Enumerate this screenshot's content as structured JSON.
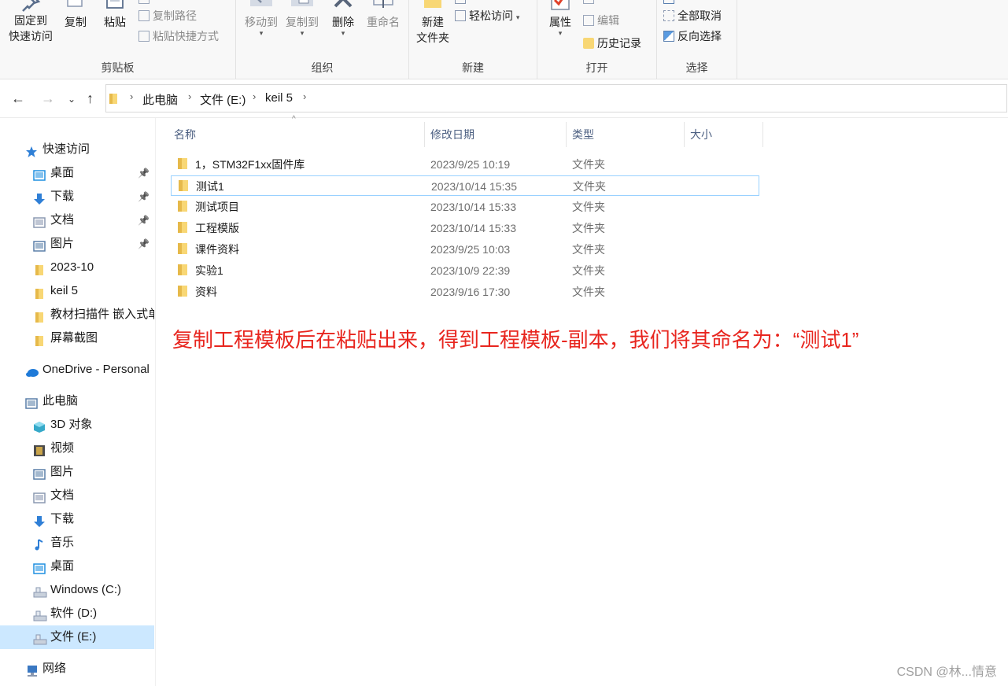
{
  "ribbon": {
    "clipboard": {
      "group_label": "剪贴板",
      "pin_label_1": "固定到",
      "pin_label_2": "快速访问",
      "copy_label": "复制",
      "paste_label": "粘贴",
      "copy_path_label": "复制路径",
      "paste_shortcut_label": "粘贴快捷方式"
    },
    "organize": {
      "group_label": "组织",
      "move_to_label": "移动到",
      "copy_to_label": "复制到",
      "delete_label": "删除",
      "rename_label": "重命名"
    },
    "new": {
      "group_label": "新建",
      "new_folder_label_1": "新建",
      "new_folder_label_2": "文件夹",
      "easy_access_label": "轻松访问"
    },
    "open": {
      "group_label": "打开",
      "properties_label": "属性",
      "edit_label": "编辑",
      "history_label": "历史记录"
    },
    "select": {
      "group_label": "选择",
      "select_none_label": "全部取消",
      "invert_selection_label": "反向选择"
    }
  },
  "address": {
    "crumbs": [
      "此电脑",
      "文件 (E:)",
      "keil 5"
    ]
  },
  "sidebar": {
    "items": [
      {
        "label": "快速访问",
        "icon": "star-icon"
      },
      {
        "label": "桌面",
        "icon": "desktop-icon",
        "pinned": true
      },
      {
        "label": "下载",
        "icon": "download-icon",
        "pinned": true
      },
      {
        "label": "文档",
        "icon": "document-icon",
        "pinned": true
      },
      {
        "label": "图片",
        "icon": "picture-icon",
        "pinned": true
      },
      {
        "label": "2023-10",
        "icon": "folder-icon"
      },
      {
        "label": "keil 5",
        "icon": "folder-icon"
      },
      {
        "label": "教材扫描件 嵌入式单",
        "icon": "folder-icon"
      },
      {
        "label": "屏幕截图",
        "icon": "folder-icon"
      },
      {
        "label": "OneDrive - Personal",
        "icon": "cloud-icon"
      },
      {
        "label": "此电脑",
        "icon": "computer-icon"
      },
      {
        "label": "3D 对象",
        "icon": "cube-icon"
      },
      {
        "label": "视频",
        "icon": "video-icon"
      },
      {
        "label": "图片",
        "icon": "picture-icon"
      },
      {
        "label": "文档",
        "icon": "document-icon"
      },
      {
        "label": "下载",
        "icon": "download-icon"
      },
      {
        "label": "音乐",
        "icon": "music-icon"
      },
      {
        "label": "桌面",
        "icon": "desktop-icon"
      },
      {
        "label": "Windows (C:)",
        "icon": "drive-icon"
      },
      {
        "label": "软件 (D:)",
        "icon": "drive-icon"
      },
      {
        "label": "文件 (E:)",
        "icon": "drive-icon",
        "selected": true
      },
      {
        "label": "网络",
        "icon": "network-icon"
      }
    ]
  },
  "columns": {
    "name": "名称",
    "modified": "修改日期",
    "type": "类型",
    "size": "大小"
  },
  "files": [
    {
      "name": "1，STM32F1xx固件库",
      "date": "2023/9/25 10:19",
      "type": "文件夹"
    },
    {
      "name": "测试1",
      "date": "2023/10/14 15:35",
      "type": "文件夹"
    },
    {
      "name": "测试项目",
      "date": "2023/10/14 15:33",
      "type": "文件夹"
    },
    {
      "name": "工程模版",
      "date": "2023/10/14 15:33",
      "type": "文件夹"
    },
    {
      "name": "课件资料",
      "date": "2023/9/25 10:03",
      "type": "文件夹"
    },
    {
      "name": "实验1",
      "date": "2023/10/9 22:39",
      "type": "文件夹"
    },
    {
      "name": "资料",
      "date": "2023/9/16 17:30",
      "type": "文件夹"
    }
  ],
  "annotation": "复制工程模板后在粘贴出来，得到工程模板-副本，我们将其命名为：“测试1”",
  "watermark": "CSDN @林...情意",
  "colors": {
    "annotation": "#e8261f",
    "selection": "#cce8ff",
    "folder": "#f8d775",
    "header_text": "#4d6082"
  }
}
